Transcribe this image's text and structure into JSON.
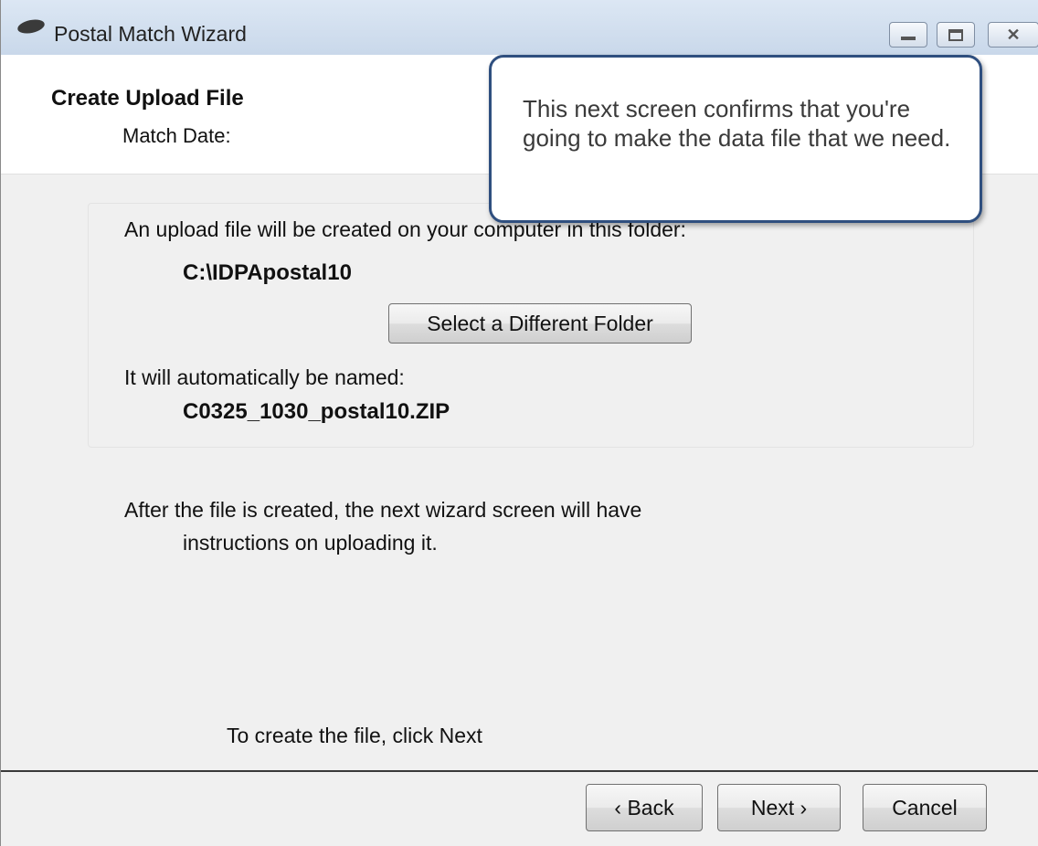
{
  "window": {
    "title": "Postal Match Wizard",
    "minimize_glyph": "",
    "close_glyph": "✕"
  },
  "header": {
    "title": "Create Upload File",
    "match_date_label": "Match Date:"
  },
  "folder_section": {
    "intro": "An upload file will be created on your computer in this folder:",
    "folder_path": "C:\\IDPApostal10",
    "select_folder_label": "Select a Different Folder",
    "name_intro": "It will automatically be named:",
    "file_name": "C0325_1030_postal10.ZIP"
  },
  "info": {
    "line1": "After the file is created, the next wizard screen will have",
    "line2": "instructions on uploading it."
  },
  "footer_hint": "To create the file, click Next",
  "buttons": {
    "back": "‹ Back",
    "next": "Next ›",
    "cancel": "Cancel"
  },
  "callout": {
    "text": "This next screen confirms that you're going to make the data file that we need."
  },
  "colors": {
    "callout_border": "#2f4f7f",
    "titlebar": "#dce7f4"
  }
}
